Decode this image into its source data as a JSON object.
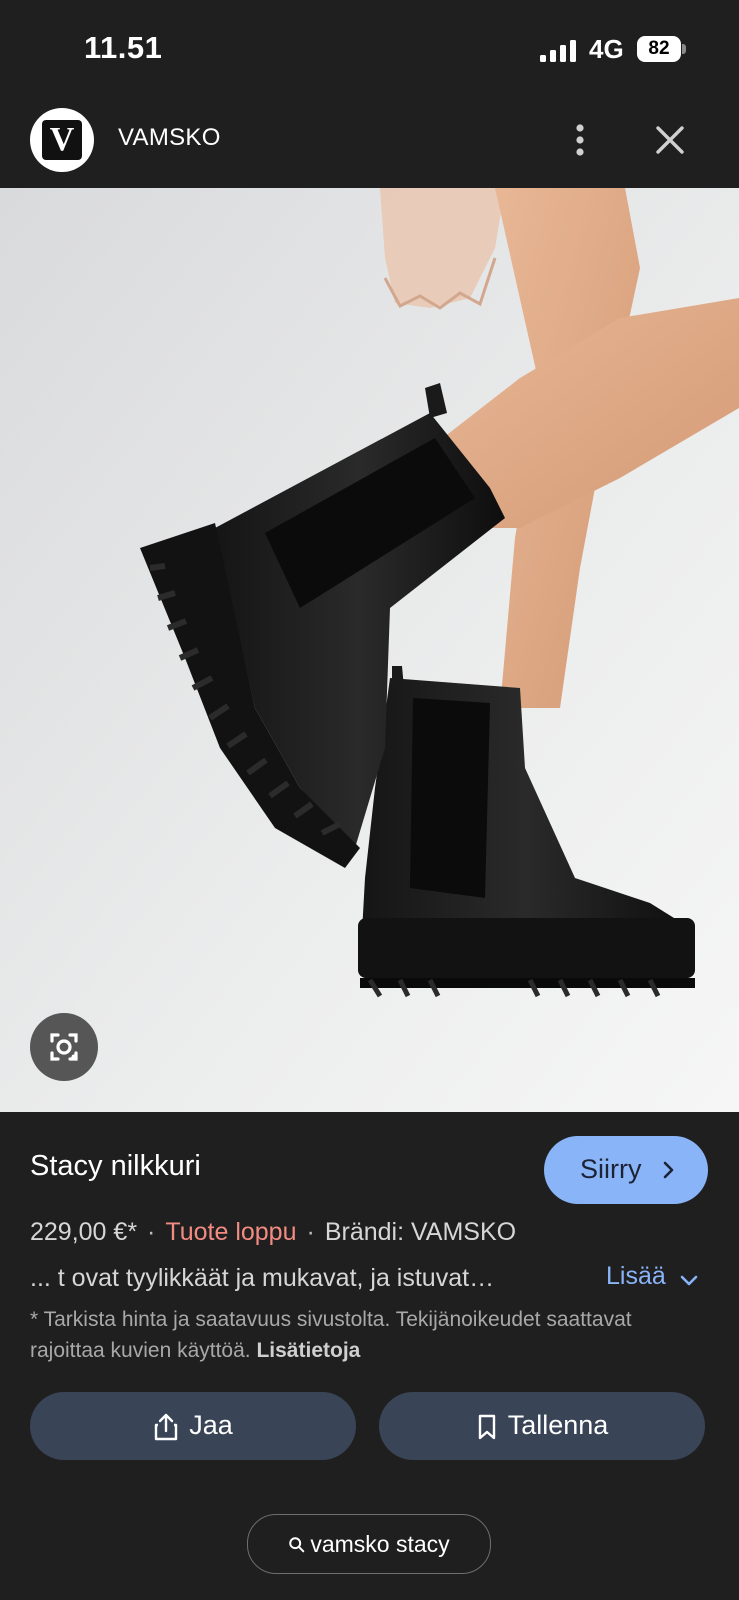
{
  "status": {
    "time": "11.51",
    "network": "4G",
    "battery": "82"
  },
  "header": {
    "logo_letter": "V",
    "site_name": "VAMSKO"
  },
  "product": {
    "title": "Stacy nilkkuri",
    "go_label": "Siirry",
    "price": "229,00 €*",
    "stock": "Tuote loppu",
    "brand": "Brändi: VAMSKO",
    "description": "... t ovat tyylikkäät ja mukavat, ja istuvat…",
    "more_label": "Lisää",
    "disclaimer": "* Tarkista hinta ja saatavuus sivustolta. Tekijänoikeudet saattavat rajoittaa kuvien käyttöä.",
    "disclaimer_link": "Lisätietoja"
  },
  "actions": {
    "share_label": "Jaa",
    "save_label": "Tallenna"
  },
  "search_chip": {
    "query": "vamsko stacy"
  },
  "icons": {
    "more": "more-vertical-icon",
    "close": "close-icon",
    "lens": "google-lens-icon",
    "share": "share-icon",
    "save": "bookmark-icon",
    "search": "search-icon"
  },
  "colors": {
    "background": "#1f1f1f",
    "accent": "#8ab4f8",
    "stock_out": "#f28b82",
    "pill": "#394457"
  }
}
